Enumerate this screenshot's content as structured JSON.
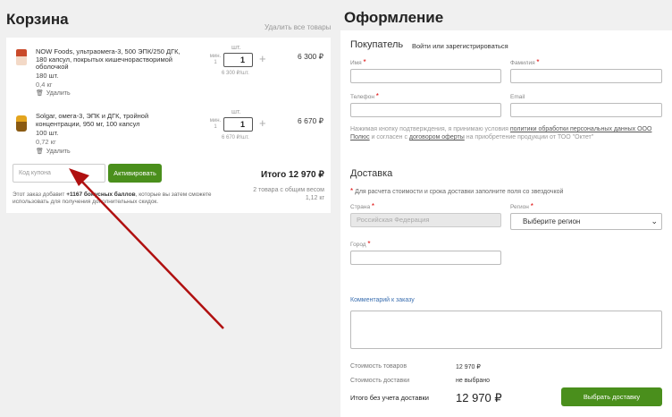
{
  "cart": {
    "title": "Корзина",
    "clear_label": "Удалить все товары",
    "items": [
      {
        "name": "NOW Foods, ультраомега-3, 500 ЭПК/250 ДГК, 180 капсул, покрытых кишечнорастворимой оболочкой",
        "pack": "180 шт.",
        "weight": "0,4 кг",
        "delete_label": "Удалить",
        "min_label": "мин. 1",
        "unit_label": "шт.",
        "qty": "1",
        "unit_price": "6 300 ₽/шт.",
        "price": "6 300 ₽"
      },
      {
        "name": "Solgar, омега-3, ЭПК и ДГК, тройной концентрации, 950 мг, 100 капсул",
        "pack": "100 шт.",
        "weight": "0,72 кг",
        "delete_label": "Удалить",
        "min_label": "мин. 1",
        "unit_label": "шт.",
        "qty": "1",
        "unit_price": "6 670 ₽/шт.",
        "price": "6 670 ₽"
      }
    ],
    "coupon_placeholder": "Код купона",
    "activate_label": "Активировать",
    "total": "Итого 12 970 ₽",
    "bonus_prefix": "Этот заказ добавит ",
    "bonus_amount": "+1167 бонусных баллов",
    "bonus_suffix": ", которые вы затем сможете использовать для получения дополнительных скидок.",
    "summary_count": "2 товара с общим весом",
    "summary_weight": "1,12 кг"
  },
  "checkout": {
    "title": "Оформление",
    "buyer": {
      "title": "Покупатель",
      "login_link": "Войти или зарегистрироваться",
      "first_name_label": "Имя",
      "last_name_label": "Фамилия",
      "phone_label": "Телефон",
      "email_label": "Email",
      "terms_before": "Нажимая кнопку подтверждения, я принимаю условия ",
      "terms_link1": "политики обработки персональных данных ООО Полюс",
      "terms_mid": " и согласен с ",
      "terms_link2": "договором оферты",
      "terms_after": " на приобретение продукции от ТОО \"Октет\""
    },
    "delivery": {
      "title": "Доставка",
      "note": "Для расчета стоимости и срока доставки заполните поля со звездочкой",
      "country_label": "Страна",
      "country_value": "Российская Федерация",
      "region_label": "Регион",
      "region_value": "Выберите регион",
      "city_label": "Город"
    },
    "comment_link": "Комментарий к заказу",
    "goods_cost_label": "Стоимость товаров",
    "goods_cost_value": "12 970 ₽",
    "delivery_cost_label": "Стоимость доставки",
    "delivery_cost_value": "не выбрано",
    "total_label": "Итого без учета доставки",
    "total_value": "12 970 ₽",
    "submit_label": "Выбрать доставку"
  },
  "colors": {
    "accent_green": "#4a8f1c",
    "required_red": "#d00000",
    "annotation_arrow": "#b01010",
    "link_blue": "#3b6fb0"
  }
}
